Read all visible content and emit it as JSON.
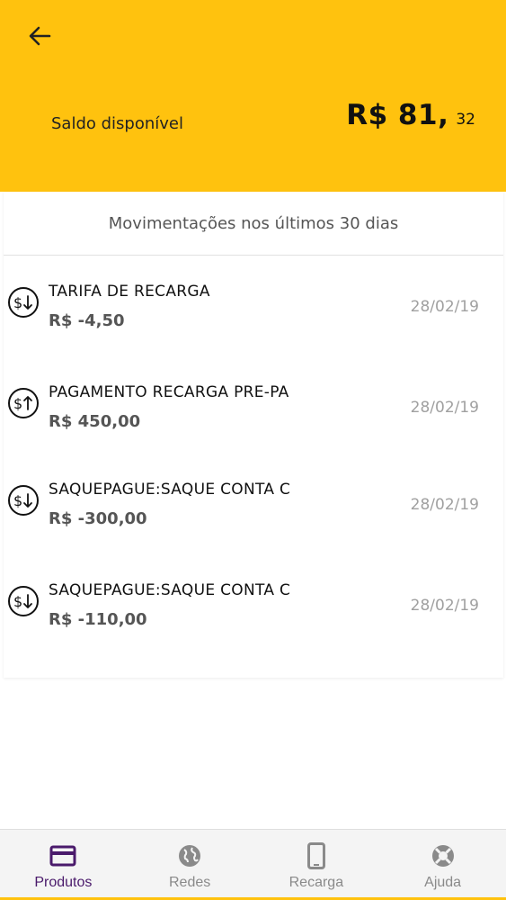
{
  "header": {
    "balance_label": "Saldo disponível",
    "balance_main": "R$ 81,",
    "balance_cents": "32",
    "background_color": "#ffc20e"
  },
  "period_label": "Movimentações nos últimos 30 dias",
  "transactions": [
    {
      "title": "TARIFA DE RECARGA",
      "amount": "R$ -4,50",
      "date": "28/02/19",
      "direction": "down"
    },
    {
      "title": "PAGAMENTO RECARGA PRE-PA",
      "amount": "R$ 450,00",
      "date": "28/02/19",
      "direction": "up"
    },
    {
      "title": "SAQUEPAGUE:SAQUE CONTA C",
      "amount": "R$ -300,00",
      "date": "28/02/19",
      "direction": "down"
    },
    {
      "title": "SAQUEPAGUE:SAQUE CONTA C",
      "amount": "R$ -110,00",
      "date": "28/02/19",
      "direction": "down"
    }
  ],
  "bottom_nav": {
    "items": [
      {
        "label": "Produtos",
        "icon": "card-icon",
        "active": true
      },
      {
        "label": "Redes",
        "icon": "globe-icon",
        "active": false
      },
      {
        "label": "Recarga",
        "icon": "phone-icon",
        "active": false
      },
      {
        "label": "Ajuda",
        "icon": "lifebuoy-icon",
        "active": false
      }
    ],
    "active_color": "#4a1a6b",
    "inactive_color": "#8a8a8a"
  }
}
